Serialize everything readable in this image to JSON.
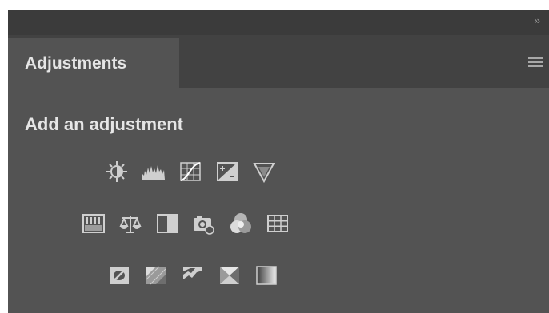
{
  "panel": {
    "collapse_glyph": "››",
    "tab_label": "Adjustments",
    "menu_icon": "panel-menu-icon",
    "heading": "Add an adjustment"
  },
  "adjustments": {
    "row1": [
      "brightness-contrast-icon",
      "levels-icon",
      "curves-icon",
      "exposure-icon",
      "vibrance-icon"
    ],
    "row2": [
      "hue-saturation-icon",
      "color-balance-icon",
      "black-white-icon",
      "photo-filter-icon",
      "channel-mixer-icon",
      "color-lookup-icon"
    ],
    "row3": [
      "invert-icon",
      "posterize-icon",
      "threshold-icon",
      "selective-color-icon",
      "gradient-map-icon"
    ]
  },
  "colors": {
    "panel_bg": "#535353",
    "tab_bar_bg": "#424242",
    "top_bar_bg": "#3b3b3b",
    "text": "#e6e6e6",
    "icon": "#cfcfcf"
  }
}
